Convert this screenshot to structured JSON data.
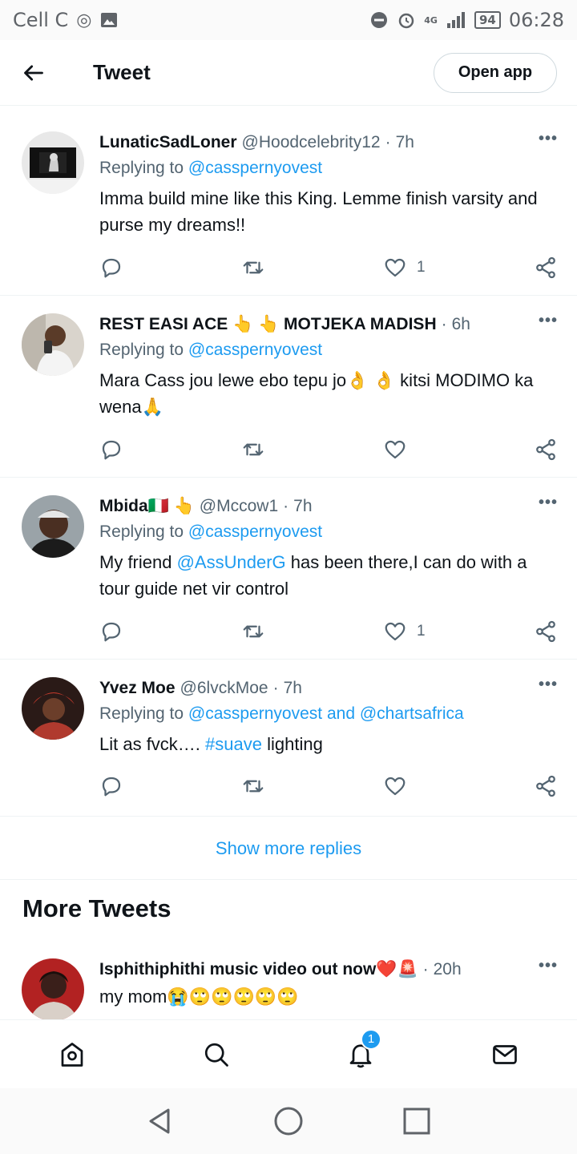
{
  "status_bar": {
    "carrier": "Cell C",
    "network": "4G",
    "battery": "94",
    "time": "06:28"
  },
  "nav": {
    "title": "Tweet",
    "open_app_label": "Open app"
  },
  "replies": [
    {
      "name": "LunaticSadLoner",
      "handle": "@Hoodcelebrity12",
      "time": "7h",
      "replying_prefix": "Replying to",
      "replying_to": "@casspernyovest",
      "text": "Imma build mine like this King. Lemme finish varsity and purse my dreams!!",
      "likes": "1"
    },
    {
      "name": "REST EASI ACE 👆 👆 MOTJEKA MADISH",
      "handle": "",
      "time": "6h",
      "replying_prefix": "Replying to",
      "replying_to": "@casspernyovest",
      "text": "Mara Cass jou lewe ebo tepu jo👌 👌 kitsi MODIMO ka wena🙏",
      "likes": ""
    },
    {
      "name": "Mbida🇮🇹 👆",
      "handle": "@Mccow1",
      "time": "7h",
      "replying_prefix": "Replying to",
      "replying_to": "@casspernyovest",
      "text_parts": [
        "My friend ",
        "@AssUnderG",
        " has been there,I can do with a tour guide net vir control"
      ],
      "likes": "1"
    },
    {
      "name": "Yvez Moe",
      "handle": "@6lvckMoe",
      "time": "7h",
      "replying_prefix": "Replying to",
      "replying_to": "@casspernyovest and @chartsafrica",
      "text_parts": [
        "Lit as fvck…. ",
        "#suave",
        " lighting"
      ],
      "likes": ""
    }
  ],
  "show_more_replies": "Show more replies",
  "more_tweets": {
    "title": "More Tweets",
    "tweet": {
      "name": "Isphithiphithi music video out now❤️🚨",
      "time": "20h",
      "text": "my mom😭🙄🙄🙄🙄🙄"
    }
  },
  "bottom_nav": {
    "notification_count": "1",
    "items": [
      "home-icon",
      "search-icon",
      "bell-icon",
      "mail-icon"
    ]
  },
  "system_nav": [
    "back-icon",
    "home-circle-icon",
    "recents-icon"
  ],
  "colors": {
    "accent": "#1d9bf0",
    "text": "#0f1419",
    "muted": "#536471"
  }
}
